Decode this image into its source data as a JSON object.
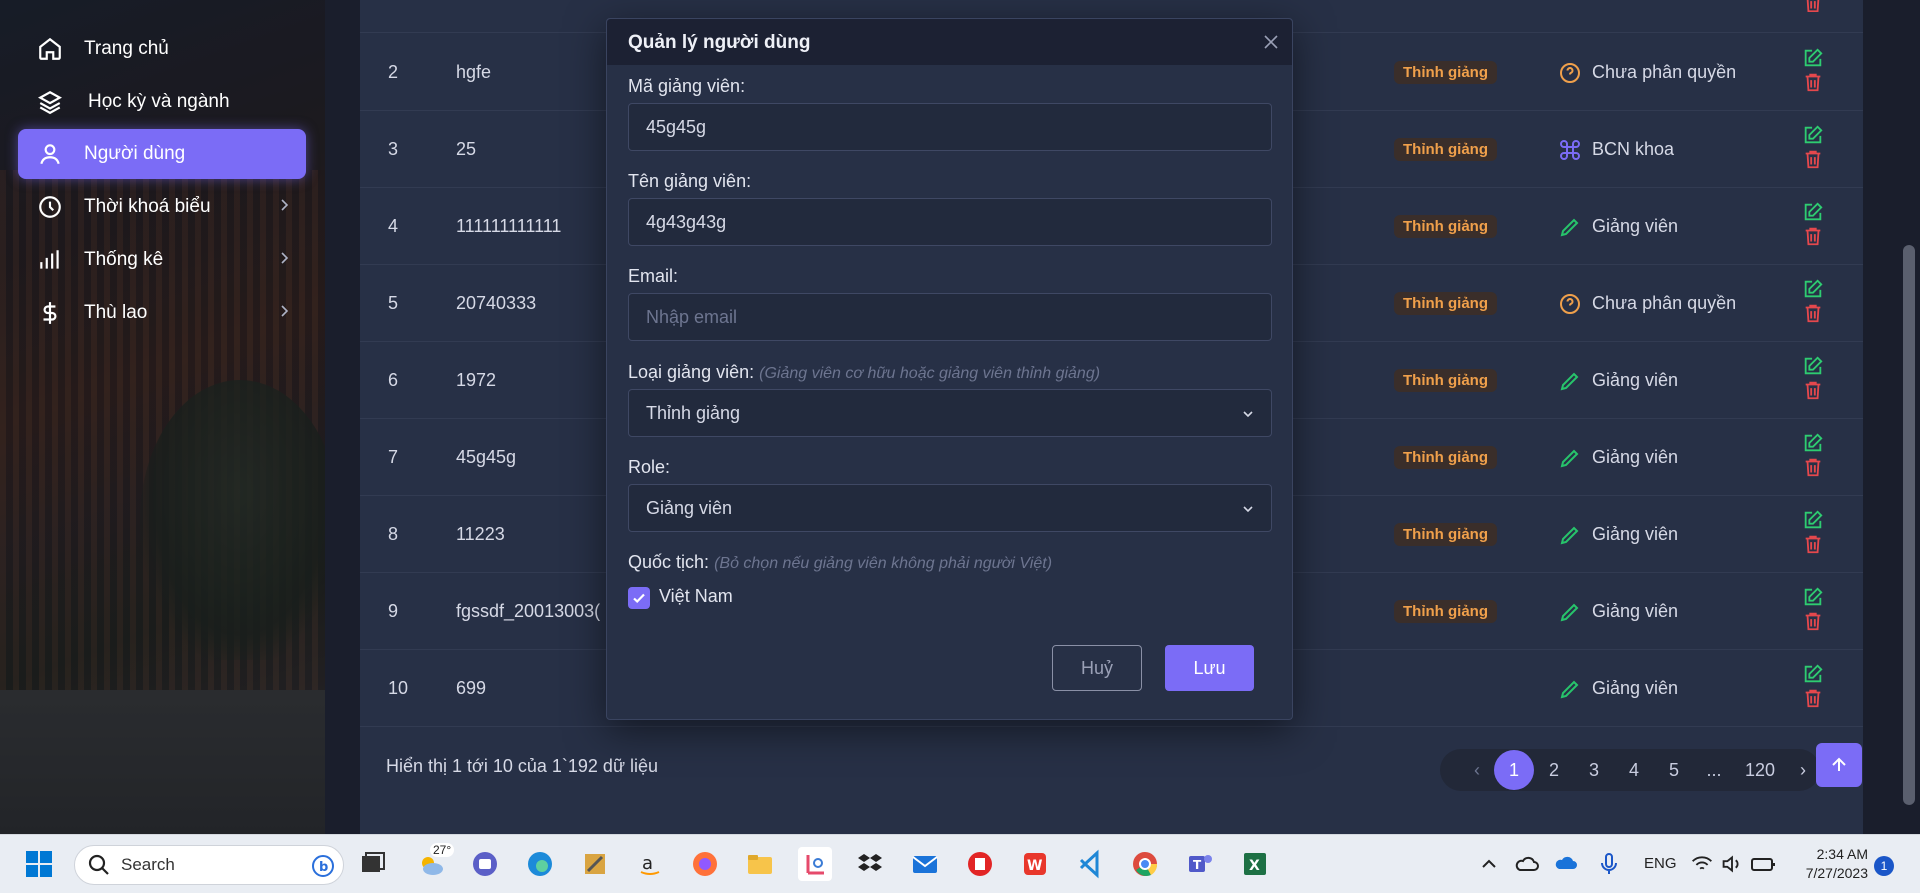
{
  "sidebar": {
    "items": [
      {
        "label": "Trang chủ",
        "icon": "home-icon"
      },
      {
        "label": "Học kỳ và ngành",
        "icon": "layers-icon"
      },
      {
        "label": "Người dùng",
        "icon": "user-icon",
        "active": true
      },
      {
        "label": "Thời khoá biểu",
        "icon": "clock-icon",
        "has_submenu": true
      },
      {
        "label": "Thống kê",
        "icon": "bar-chart-icon",
        "has_submenu": true
      },
      {
        "label": "Thù lao",
        "icon": "dollar-icon",
        "has_submenu": true
      }
    ]
  },
  "table": {
    "rows": [
      {
        "index": "2",
        "code": "hgfe",
        "type": "Thỉnh giảng",
        "role": "Chưa phân quyền",
        "role_icon": "question-icon"
      },
      {
        "index": "3",
        "code": "25",
        "type": "Thỉnh giảng",
        "role": "BCN khoa",
        "role_icon": "command-icon"
      },
      {
        "index": "4",
        "code": "111111111111",
        "type": "Thỉnh giảng",
        "role": "Giảng viên",
        "role_icon": "pencil-icon"
      },
      {
        "index": "5",
        "code": "20740333",
        "type": "Thỉnh giảng",
        "role": "Chưa phân quyền",
        "role_icon": "question-icon"
      },
      {
        "index": "6",
        "code": "1972",
        "type": "Thỉnh giảng",
        "role": "Giảng viên",
        "role_icon": "pencil-icon"
      },
      {
        "index": "7",
        "code": "45g45g",
        "type": "Thỉnh giảng",
        "role": "Giảng viên",
        "role_icon": "pencil-icon"
      },
      {
        "index": "8",
        "code": "11223",
        "type": "Thỉnh giảng",
        "role": "Giảng viên",
        "role_icon": "pencil-icon"
      },
      {
        "index": "9",
        "code": "fgssdf_20013003(",
        "type": "Thỉnh giảng",
        "role": "Giảng viên",
        "role_icon": "pencil-icon"
      },
      {
        "index": "10",
        "code": "699",
        "type": "",
        "role": "Giảng viên",
        "role_icon": "pencil-icon"
      }
    ],
    "footer_text": "Hiển thị 1 tới 10 của 1`192 dữ liệu"
  },
  "pagination": {
    "prev": "‹",
    "pages": [
      "1",
      "2",
      "3",
      "4",
      "5",
      "...",
      "120"
    ],
    "current": "1",
    "next": "›"
  },
  "modal": {
    "title": "Quản lý người dùng",
    "lecturer_code_label": "Mã giảng viên:",
    "lecturer_code_value": "45g45g",
    "lecturer_name_label": "Tên giảng viên:",
    "lecturer_name_value": "4g43g43g",
    "email_label": "Email:",
    "email_placeholder": "Nhập email",
    "type_label": "Loại giảng viên:",
    "type_hint": "(Giảng viên cơ hữu hoặc giảng viên thỉnh giảng)",
    "type_value": "Thỉnh giảng",
    "role_label": "Role:",
    "role_value": "Giảng viên",
    "nationality_label": "Quốc tịch:",
    "nationality_hint": "(Bỏ chọn nếu giảng viên không phải người Việt)",
    "nationality_checkbox_label": "Việt Nam",
    "nationality_checked": true,
    "cancel_label": "Huỷ",
    "save_label": "Lưu"
  },
  "taskbar": {
    "search_label": "Search",
    "weather_temp": "27°",
    "language": "ENG",
    "time": "2:34 AM",
    "date": "7/27/2023",
    "notification_count": "1"
  },
  "colors": {
    "accent": "#7b6cf6",
    "badge_text": "#f0a04b",
    "edit_green": "#2ecc71",
    "delete_red": "#e5484d",
    "pencil_green": "#27c46b",
    "question_orange": "#f0a04b",
    "command_purple": "#7b6cf6"
  }
}
